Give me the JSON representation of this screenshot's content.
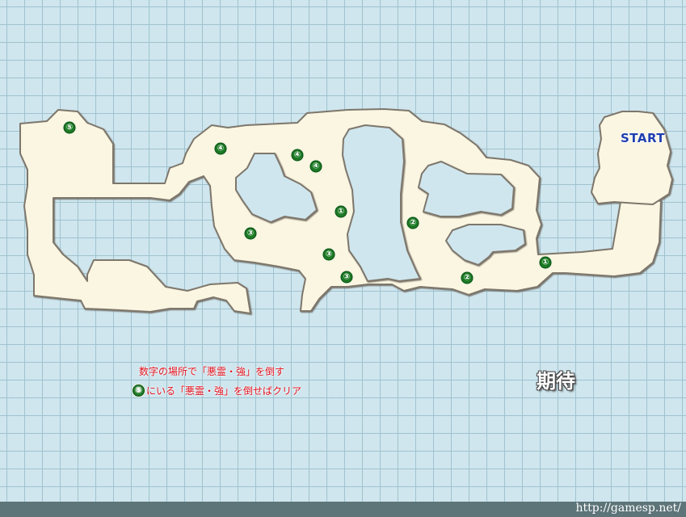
{
  "map": {
    "start_label": "START",
    "expect_label": "期待",
    "markers": [
      {
        "id": "marker-5-west-room",
        "symbol": "⑤"
      },
      {
        "id": "marker-4-upper-left",
        "symbol": "④"
      },
      {
        "id": "marker-4-center-a",
        "symbol": "④"
      },
      {
        "id": "marker-4-center-b",
        "symbol": "④"
      },
      {
        "id": "marker-1-center",
        "symbol": "①"
      },
      {
        "id": "marker-3-left",
        "symbol": "③"
      },
      {
        "id": "marker-3-center",
        "symbol": "③"
      },
      {
        "id": "marker-3-lower",
        "symbol": "③"
      },
      {
        "id": "marker-2-upper",
        "symbol": "②"
      },
      {
        "id": "marker-2-lower",
        "symbol": "②"
      },
      {
        "id": "marker-1-east",
        "symbol": "①"
      }
    ],
    "colors": {
      "water": "#cfe6ee",
      "grid": "#9fc2cf",
      "floor": "#fbf6e2",
      "wall": "#7e776c",
      "marker": "#1c7a25",
      "legend_text": "#e0101c",
      "start_text": "#1f3fb0"
    }
  },
  "legend": {
    "line1": "数字の場所で「悪霊・強」を倒す",
    "line2_marker": "⑤",
    "line2_text": "にいる「悪霊・強」を倒せばクリア"
  },
  "footer": {
    "url": "http://gamesp.net/"
  }
}
